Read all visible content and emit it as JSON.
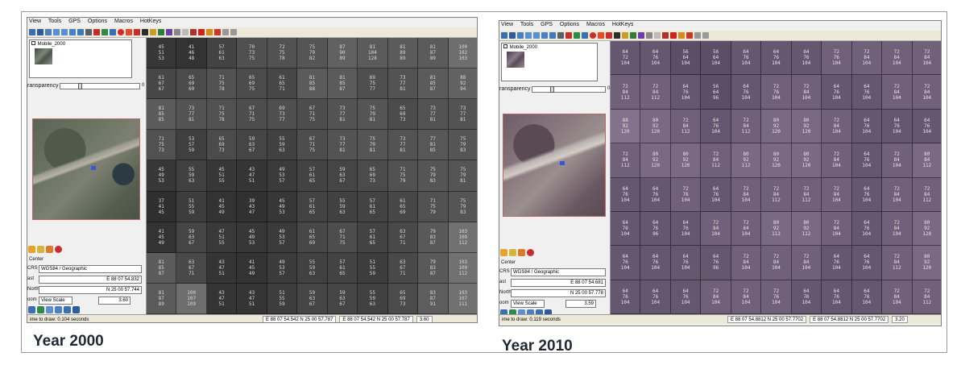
{
  "left": {
    "menu": [
      "View",
      "Tools",
      "GPS",
      "Options",
      "Macros",
      "HotKeys"
    ],
    "layer_name": "Mobile_2000",
    "transparency_label": "ransparency",
    "transparency_value": "0",
    "panel_center": "Center",
    "crs_label": "CRS",
    "crs_value": "WGS84 / Geographic",
    "east_label": "ast",
    "east_value": "E 88 07 54.832",
    "north_label": "North",
    "north_value": "N 25 00 57.744",
    "zoom_label": "oom",
    "zoom_mode": "View Scale",
    "zoom_value": "3.60",
    "status_time": "ime to draw: 0.104 seconds",
    "status_coord1": "E 88 07 54.542  N 25 00 57.787",
    "status_coord2": "E 88 07 54.542  N 25 00 57.787",
    "status_scale": "3.60",
    "caption": "Year 2000"
  },
  "right": {
    "menu": [
      "View",
      "Tools",
      "GPS",
      "Options",
      "Macros",
      "HotKeys"
    ],
    "layer_name": "Mobile_2000",
    "transparency_label": "ransparency",
    "transparency_value": "0",
    "panel_center": "Center",
    "crs_label": "CRS",
    "crs_value": "WGS84 / Geographic",
    "east_label": "ast",
    "east_value": "E 88 07 54.681",
    "north_label": "North",
    "north_value": "N 25 00 57.778",
    "zoom_label": "oom",
    "zoom_mode": "View Scale",
    "zoom_value": "3.59",
    "status_time": "ime to draw: 0.119 seconds",
    "status_coord1": "E 88 07 54.8812  N 25 00 57.7702",
    "status_coord2": "E 88 07 54.8812  N 25 00 57.7702",
    "status_scale": "3.20",
    "caption": "Year 2010"
  },
  "colors": {
    "gray_dark": "#3a3a3a",
    "gray_light": "#7a7a7a",
    "purple_base": "#6e5c78",
    "purple_light": "#8a7c92"
  },
  "grid2000": [
    [
      "45\n51\n53",
      "41\n46\n48",
      "57\n61\n63",
      "70\n73\n75",
      "72\n75\n78",
      "75\n79\n82",
      "87\n90\n89",
      "81\n104\n128",
      "81\n89\n89",
      "81\n87\n89",
      "100\n102\n103"
    ],
    [
      "61\n67\n67",
      "65\n69\n69",
      "71\n75\n78",
      "65\n69\n75",
      "61\n65\n71",
      "81\n85\n88",
      "81\n85\n87",
      "69\n75\n77",
      "73\n77\n81",
      "81\n85\n87",
      "88\n92\n94"
    ],
    [
      "81\n85\n85",
      "73\n77\n81",
      "71\n75\n78",
      "67\n71\n75",
      "69\n73\n77",
      "67\n71\n75",
      "73\n77\n81",
      "75\n79\n81",
      "65\n69\n73",
      "73\n77\n81",
      "73\n77\n81"
    ],
    [
      "71\n75\n73",
      "53\n57\n59",
      "65\n69\n73",
      "59\n63\n67",
      "55\n59\n63",
      "67\n71\n75",
      "73\n77\n81",
      "75\n79\n81",
      "73\n77\n81",
      "77\n81\n85",
      "75\n79\n83"
    ],
    [
      "45\n49\n53",
      "55\n59\n63",
      "45\n51\n55",
      "43\n47\n51",
      "49\n53\n57",
      "57\n61\n65",
      "59\n63\n67",
      "65\n69\n73",
      "71\n75\n79",
      "75\n79\n83",
      "75\n79\n81"
    ],
    [
      "37\n41\n45",
      "51\n55\n59",
      "41\n45\n49",
      "39\n43\n47",
      "45\n49\n53",
      "57\n61\n65",
      "55\n59\n63",
      "57\n61\n65",
      "61\n65\n69",
      "71\n75\n79",
      "75\n79\n83"
    ],
    [
      "41\n45\n49",
      "59\n63\n67",
      "47\n51\n55",
      "45\n49\n53",
      "49\n53\n57",
      "61\n65\n69",
      "67\n71\n75",
      "57\n61\n65",
      "63\n67\n71",
      "79\n83\n87",
      "103\n109\n112"
    ],
    [
      "81\n85\n87",
      "63\n67\n71",
      "43\n47\n51",
      "41\n45\n49",
      "49\n53\n57",
      "55\n59\n63",
      "57\n61\n65",
      "51\n55\n59",
      "63\n67\n71",
      "79\n83\n87",
      "103\n109\n112"
    ],
    [
      "81\n87\n89",
      "100\n107\n109",
      "43\n47\n51",
      "43\n47\n51",
      "51\n55\n59",
      "59\n63\n67",
      "59\n63\n67",
      "55\n59\n63",
      "65\n69\n73",
      "83\n87\n91",
      "103\n107\n111"
    ]
  ],
  "grid2010": [
    [
      "64\n72\n104",
      "64\n76\n104",
      "56\n64\n104",
      "56\n64\n104",
      "64\n76\n104",
      "64\n76\n104",
      "64\n76\n104",
      "72\n76\n104",
      "72\n84\n104",
      "72\n84\n104",
      "72\n84\n104"
    ],
    [
      "72\n84\n112",
      "72\n84\n112",
      "64\n76\n104",
      "56\n64\n96",
      "64\n76\n104",
      "72\n76\n104",
      "72\n84\n104",
      "64\n76\n104",
      "64\n76\n104",
      "72\n84\n104",
      "72\n84\n104"
    ],
    [
      "88\n92\n120",
      "80\n92\n120",
      "72\n84\n112",
      "64\n76\n104",
      "72\n84\n112",
      "80\n92\n120",
      "80\n92\n120",
      "72\n84\n104",
      "64\n76\n104",
      "64\n76\n104",
      "64\n76\n104"
    ],
    [
      "72\n84\n112",
      "80\n92\n120",
      "80\n92\n120",
      "72\n84\n112",
      "80\n92\n112",
      "80\n92\n120",
      "80\n92\n120",
      "72\n84\n104",
      "64\n76\n104",
      "72\n84\n104",
      "80\n84\n112"
    ],
    [
      "64\n76\n104",
      "64\n76\n104",
      "72\n76\n104",
      "64\n76\n104",
      "72\n84\n104",
      "72\n84\n112",
      "72\n84\n112",
      "72\n84\n104",
      "64\n76\n104",
      "72\n84\n104",
      "72\n84\n112"
    ],
    [
      "64\n76\n104",
      "64\n76\n96",
      "64\n76\n104",
      "72\n84\n104",
      "72\n84\n104",
      "80\n92\n112",
      "80\n92\n112",
      "72\n84\n104",
      "64\n76\n104",
      "72\n84\n104",
      "80\n92\n120"
    ],
    [
      "64\n76\n104",
      "64\n76\n104",
      "64\n76\n104",
      "64\n76\n96",
      "72\n84\n104",
      "72\n84\n104",
      "72\n84\n104",
      "64\n76\n104",
      "64\n76\n104",
      "72\n84\n112",
      "80\n92\n120"
    ],
    [
      "64\n76\n104",
      "64\n76\n104",
      "64\n76\n104",
      "72\n84\n104",
      "72\n84\n104",
      "72\n76\n104",
      "64\n76\n104",
      "64\n76\n104",
      "64\n76\n104",
      "72\n84\n104",
      "72\n84\n112"
    ]
  ]
}
